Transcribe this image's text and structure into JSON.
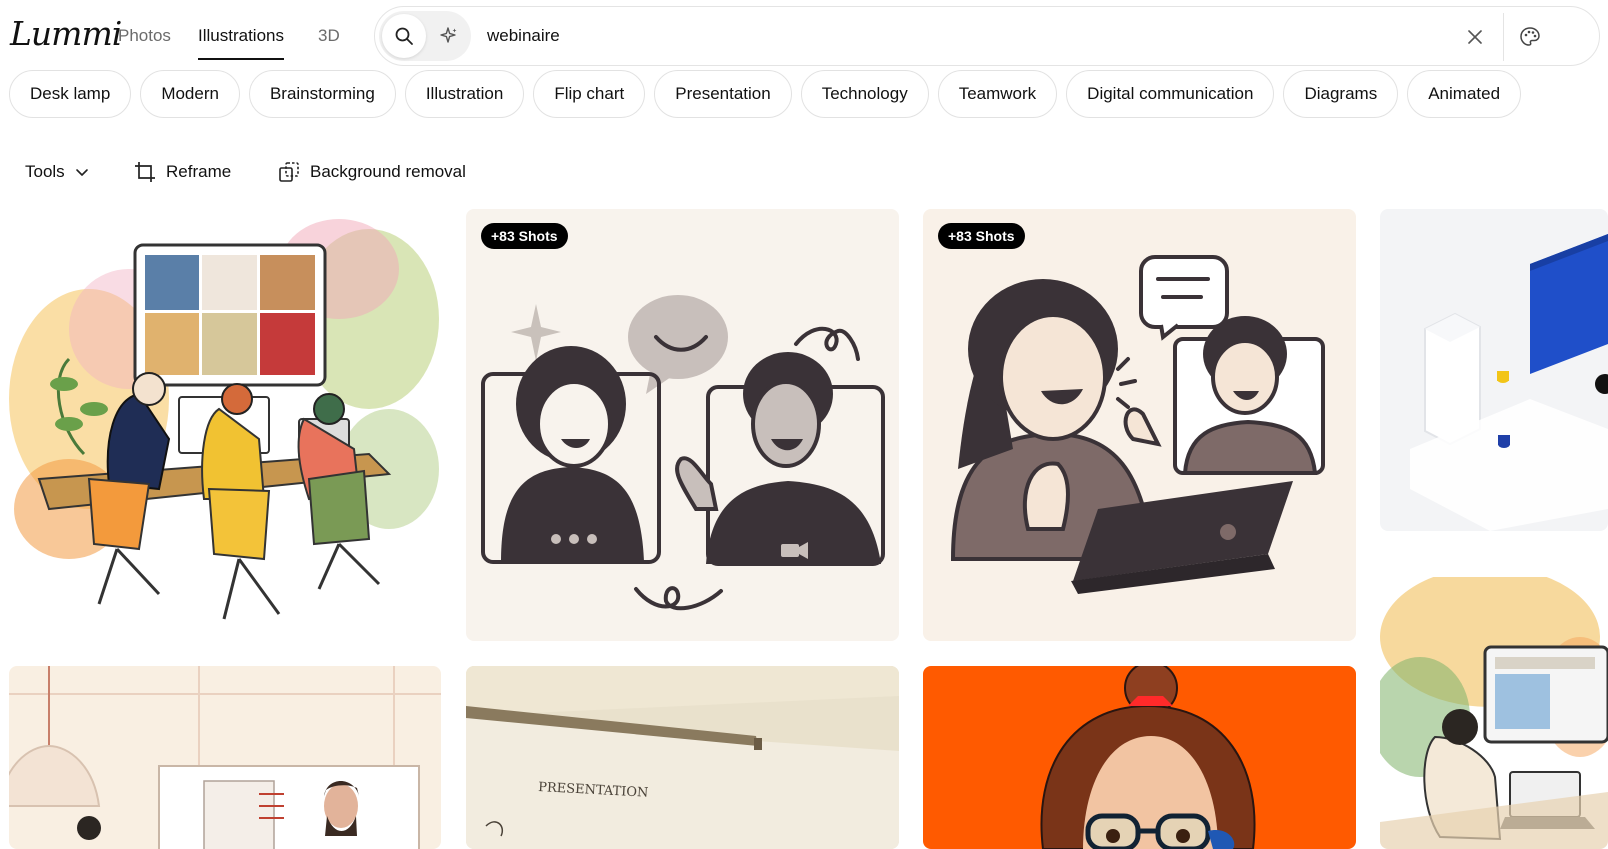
{
  "app": {
    "logo_text": "Lummi"
  },
  "nav": {
    "tabs": [
      {
        "label": "Photos",
        "active": false
      },
      {
        "label": "Illustrations",
        "active": true
      },
      {
        "label": "3D",
        "active": false
      }
    ]
  },
  "search": {
    "value": "webinaire",
    "placeholder": "",
    "icons": [
      "search-icon",
      "sparkle-icon",
      "close-icon",
      "palette-icon"
    ]
  },
  "chips": [
    "Desk lamp",
    "Modern",
    "Brainstorming",
    "Illustration",
    "Flip chart",
    "Presentation",
    "Technology",
    "Teamwork",
    "Digital communication",
    "Diagrams",
    "Animated"
  ],
  "tools": {
    "tools_label": "Tools",
    "reframe_label": "Reframe",
    "bg_removal_label": "Background removal"
  },
  "results": {
    "items": [
      {
        "id": "r1",
        "badge": ""
      },
      {
        "id": "r2",
        "badge": "+83 Shots"
      },
      {
        "id": "r3",
        "badge": "+83 Shots"
      },
      {
        "id": "r4",
        "badge": ""
      },
      {
        "id": "r5",
        "badge": ""
      },
      {
        "id": "r6",
        "badge": ""
      },
      {
        "id": "r7",
        "badge": ""
      },
      {
        "id": "r8",
        "badge": ""
      }
    ],
    "whiteboard_text": "PRESENTATION"
  },
  "colors": {
    "accent": "#111111",
    "chip_border": "#e2e2e2",
    "card_bg_warm": "#f7f2ec",
    "orange": "#ff5a00"
  }
}
